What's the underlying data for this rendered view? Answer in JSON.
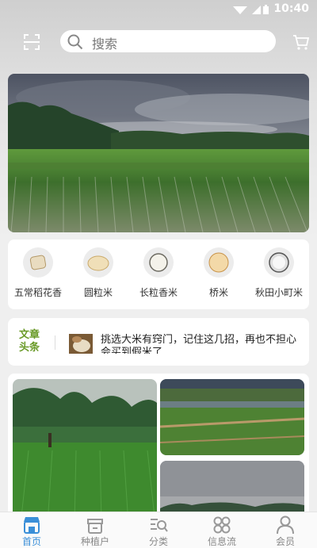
{
  "status_bar": {
    "time": "10:40"
  },
  "search": {
    "placeholder": "搜索"
  },
  "categories": [
    {
      "label": "五常稻花香"
    },
    {
      "label": "圆粒米"
    },
    {
      "label": "长粒香米"
    },
    {
      "label": "桥米"
    },
    {
      "label": "秋田小町米"
    }
  ],
  "news": {
    "tag": "文章头条",
    "headline": "挑选大米有窍门，记住这几招，再也不担心会买到假米了"
  },
  "tabbar": {
    "items": [
      {
        "label": "首页",
        "active": true
      },
      {
        "label": "种植户"
      },
      {
        "label": "分类"
      },
      {
        "label": "信息流"
      },
      {
        "label": "会员"
      }
    ]
  },
  "colors": {
    "accent": "#3a8fd8",
    "news_tag": "#6a9a28"
  }
}
